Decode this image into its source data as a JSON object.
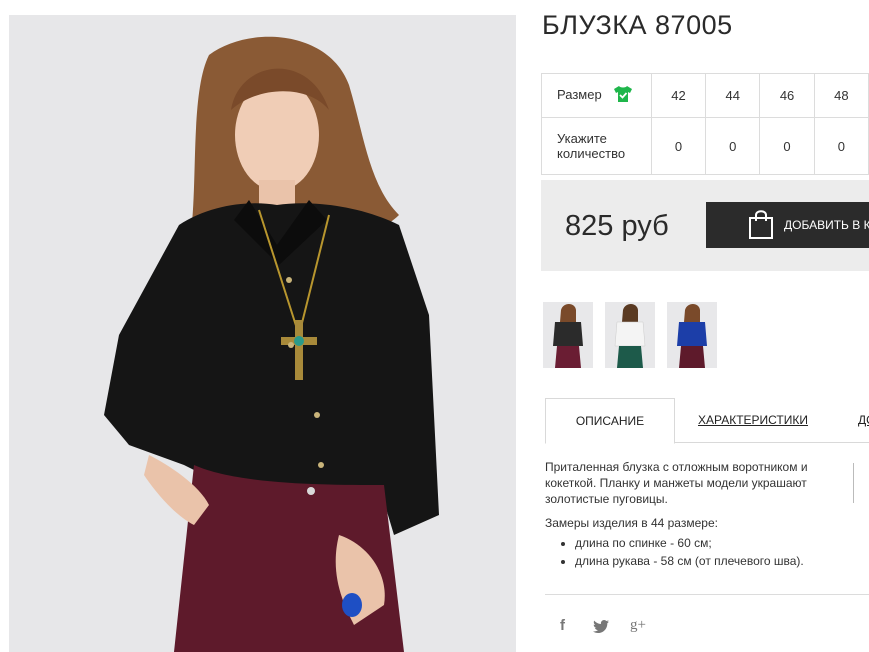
{
  "product": {
    "title": "БЛУЗКА 87005",
    "image_alt": "Model wearing black blouse and burgundy trousers"
  },
  "sizes": {
    "size_label": "Размер",
    "size_icon": "tshirt-check-icon",
    "qty_label_line1": "Укажите",
    "qty_label_line2": "количество",
    "values": [
      "42",
      "44",
      "46",
      "48"
    ],
    "quantities": [
      "0",
      "0",
      "0",
      "0"
    ],
    "icon_color": "#1fb64b"
  },
  "purchase": {
    "price": "825 руб",
    "add_label": "ДОБАВИТЬ В КОРЗИНУ",
    "bag_icon": "shopping-bag-icon"
  },
  "thumbnails": [
    {
      "name": "thumb-black-blouse",
      "color": "#2b2b2b"
    },
    {
      "name": "thumb-white-blouse",
      "color": "#f4f4f4"
    },
    {
      "name": "thumb-blue-blouse",
      "color": "#1c3ea8"
    }
  ],
  "tabs": {
    "description": "ОПИСАНИЕ",
    "characteristics": "ХАРАКТЕРИСТИКИ",
    "third": "ДО"
  },
  "description": {
    "text": "Приталенная блузка с отложным воротником и кокеткой. Планку и манжеты модели украшают золотистые пуговицы.",
    "measure_title": "Замеры изделия в 44 размере:",
    "items": [
      "длина по спинке - 60 см;",
      "длина рукава - 58 см (от плечевого шва)."
    ]
  },
  "social": {
    "facebook": "f",
    "twitter": "twitter-icon",
    "googleplus": "g+"
  },
  "colors": {
    "dark": "#2b2b2b",
    "panel": "#ececec",
    "border": "#dcdcdc"
  }
}
